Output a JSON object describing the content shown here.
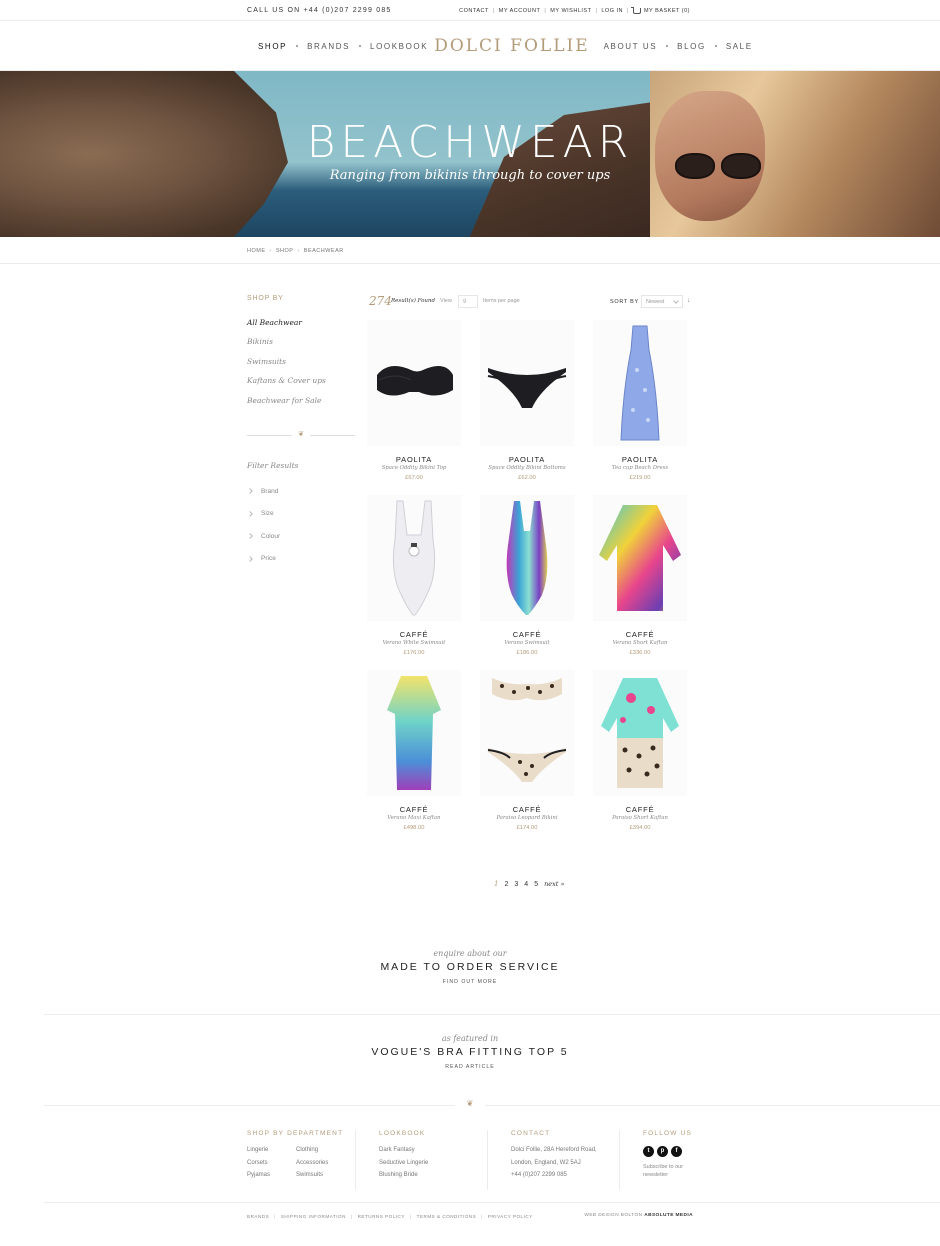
{
  "topbar": {
    "phone": "CALL US ON +44 (0)207 2299 085",
    "links": [
      "CONTACT",
      "MY ACCOUNT",
      "MY WISHLIST",
      "LOG IN"
    ],
    "basket": "MY BASKET (0)"
  },
  "nav": {
    "left": [
      "SHOP",
      "BRANDS",
      "LOOKBOOK"
    ],
    "logo": "DOLCI FOLLIE",
    "right": [
      "ABOUT US",
      "BLOG",
      "SALE"
    ]
  },
  "hero": {
    "title": "BEACHWEAR",
    "subtitle": "Ranging from bikinis through to cover ups"
  },
  "breadcrumb": [
    "HOME",
    "SHOP",
    "BEACHWEAR"
  ],
  "sidebar": {
    "shop_by": "SHOP BY",
    "categories": [
      "All Beachwear",
      "Bikinis",
      "Swimsuits",
      "Kaftans & Cover ups",
      "Beachwear for Sale"
    ],
    "filter_title": "Filter Results",
    "filters": [
      "Brand",
      "Size",
      "Colour",
      "Price"
    ]
  },
  "results": {
    "count": "274",
    "label": "Result(s) Found",
    "view_label": "View",
    "view_value": "9",
    "per_page": "Items per page",
    "sort_label": "SORT BY",
    "sort_value": "Newest",
    "sort_dir": "↓"
  },
  "products": [
    {
      "brand": "PAOLITA",
      "name": "Space Oddity Bikini Top",
      "price": "£67.00",
      "icon": "bikini-top"
    },
    {
      "brand": "PAOLITA",
      "name": "Space Oddity Bikini Bottoms",
      "price": "£62.00",
      "icon": "bikini-bottom"
    },
    {
      "brand": "PAOLITA",
      "name": "Tea cup Beach Dress",
      "price": "£219.00",
      "icon": "beach-dress"
    },
    {
      "brand": "CAFFÉ",
      "name": "Verano White Swimsuit",
      "price": "£176.00",
      "icon": "white-swimsuit"
    },
    {
      "brand": "CAFFÉ",
      "name": "Verano Swimsuit",
      "price": "£186.00",
      "icon": "print-swimsuit"
    },
    {
      "brand": "CAFFÉ",
      "name": "Verano Short Kaftan",
      "price": "£336.00",
      "icon": "short-kaftan"
    },
    {
      "brand": "CAFFÉ",
      "name": "Verano Maxi Kaftan",
      "price": "£498.00",
      "icon": "maxi-kaftan"
    },
    {
      "brand": "CAFFÉ",
      "name": "Paraiso Leopard Bikini",
      "price": "£174.00",
      "icon": "leopard-bikini"
    },
    {
      "brand": "CAFFÉ",
      "name": "Paraiso Short Kaftan",
      "price": "£394.00",
      "icon": "paraiso-kaftan"
    }
  ],
  "pagination": {
    "current": "1",
    "pages": [
      "2",
      "3",
      "4",
      "5"
    ],
    "next": "next »"
  },
  "promo1": {
    "kicker": "enquire about our",
    "title": "MADE TO ORDER SERVICE",
    "link": "FIND OUT MORE"
  },
  "promo2": {
    "kicker": "as featured in",
    "title": "VOGUE'S BRA FITTING TOP 5",
    "link": "READ ARTICLE"
  },
  "footer": {
    "department": {
      "title": "SHOP BY DEPARTMENT",
      "col1": [
        "Lingerie",
        "Corsets",
        "Pyjamas"
      ],
      "col2": [
        "Clothing",
        "Accessories",
        "Swimsuits"
      ]
    },
    "lookbook": {
      "title": "LOOKBOOK",
      "links": [
        "Dark Fantasy",
        "Seductive Lingerie",
        "Blushing Bride"
      ]
    },
    "contact": {
      "title": "CONTACT",
      "lines": [
        "Dolci Follie, 28A Hereford Road,",
        "London, England, W2 5AJ",
        "+44 (0)207 2299 085"
      ]
    },
    "follow": {
      "title": "FOLLOW US",
      "social": [
        "twitter-icon",
        "pinterest-icon",
        "facebook-icon"
      ],
      "subscribe": "Subscribe to our newsletter"
    },
    "bottom_links": [
      "BRANDS",
      "SHIPPING INFORMATION",
      "RETURNS POLICY",
      "TERMS & CONDITIONS",
      "PRIVACY POLICY"
    ],
    "credit_prefix": "WEB DESIGN BOLTON",
    "credit_name": "ABSOLUTE MEDIA"
  },
  "colors": {
    "accent": "#b39b7a",
    "text": "#333333",
    "border": "#ececec"
  }
}
